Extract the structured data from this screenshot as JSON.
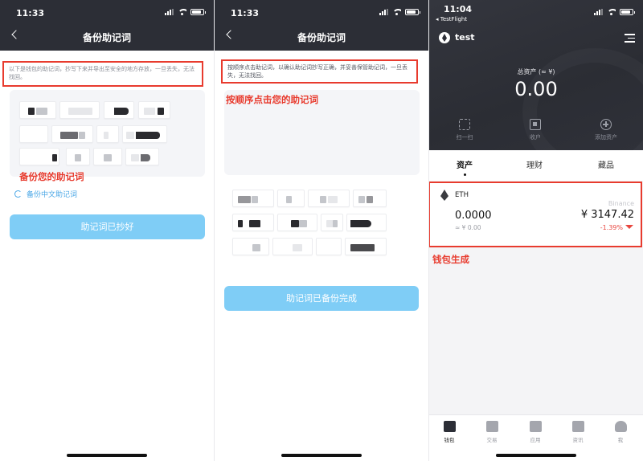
{
  "phone1": {
    "status_time": "11:33",
    "nav_title": "备份助记词",
    "notice": "以下是钱包的助记词，抄写下来并导出至安全的地方存放，一旦丢失，无法找回。",
    "annotation": "备份您的助记词",
    "cn_link": "备份中文助记词",
    "button": "助记词已抄好"
  },
  "phone2": {
    "status_time": "11:33",
    "nav_title": "备份助记词",
    "notice": "按顺序点击助记词，以确认助记词抄写正确，并妥善保管助记词，一旦丢失，无法找回。",
    "annotation": "按顺序点击您的助记词",
    "button": "助记词已备份完成"
  },
  "phone3": {
    "status_time": "11:04",
    "testflight": "◂ TestFlight",
    "app_name": "test",
    "total_label": "总资产 (≈ ¥)",
    "total_value": "0.00",
    "actions": [
      "扫一扫",
      "收户",
      "添加资产"
    ],
    "tabs": [
      "资产",
      "理财",
      "藏品"
    ],
    "asset": {
      "symbol": "ETH",
      "source": "Binance",
      "balance": "0.0000",
      "cny": "≈ ¥ 0.00",
      "price": "¥ 3147.42",
      "change": "-1.39%"
    },
    "annotation": "钱包生成",
    "tabbar": [
      "钱包",
      "交易",
      "应用",
      "资讯",
      "我"
    ]
  },
  "colors": {
    "accent_blue": "#7fcdf6",
    "highlight_red": "#e83b2e",
    "dark_header": "#2c2e36",
    "negative": "#e8463f"
  }
}
